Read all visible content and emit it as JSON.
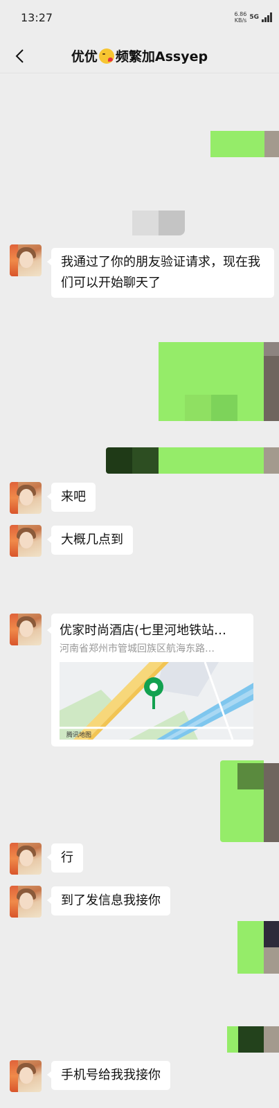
{
  "status": {
    "time": "13:27",
    "net_speed_value": "6.86",
    "net_speed_unit": "KB/s",
    "network": "5G"
  },
  "nav": {
    "title_before": "优优",
    "title_emoji": "kissing-face-emoji",
    "title_after": "频繁加Assyep"
  },
  "messages": {
    "verify": "我通过了你的朋友验证请求，现在我们可以开始聊天了",
    "laiba": "来吧",
    "dagai": "大概几点到",
    "xing": "行",
    "daole": "到了发信息我接你",
    "shoujihao": "手机号给我我接你"
  },
  "location": {
    "title": "优家时尚酒店(七里河地铁站…",
    "address": "河南省郑州市管城回族区航海东路…",
    "map_watermark": "腾讯地图"
  },
  "colors": {
    "self_bubble": "#95ec69",
    "background": "#ededed",
    "pin": "#12a150"
  }
}
